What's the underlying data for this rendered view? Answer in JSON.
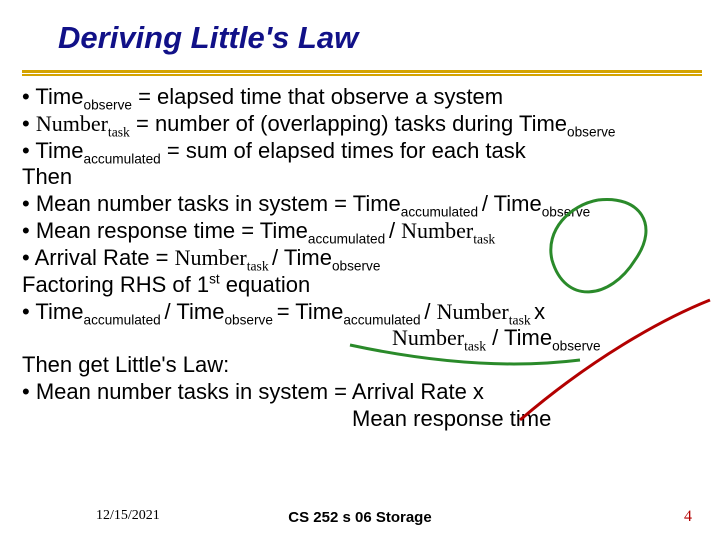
{
  "title": "Deriving Little's Law",
  "bullets": {
    "l1a": "• Time",
    "l1b": "observe",
    "l1c": " = elapsed time that observe a system",
    "l2a": "• ",
    "l2b": "Number",
    "l2c": "task",
    "l2d": " = number of (overlapping) tasks during Time",
    "l2e": "observe",
    "l3a": "• Time",
    "l3b": "accumulated",
    "l3c": " = sum of elapsed times for each task",
    "l4": "Then",
    "l5a": "• Mean number tasks in system = Time",
    "l5b": "accumulated ",
    "l5c": "/ ",
    "l5d": "Time",
    "l5e": "observe",
    "l6a": "• Mean response time = Time",
    "l6b": "accumulated ",
    "l6c": "/ ",
    "l6d": "Number",
    "l6e": "task",
    "l7a": "• Arrival Rate = ",
    "l7b": "Number",
    "l7c": "task ",
    "l7d": "/ Time",
    "l7e": "observe",
    "l8a": "Factoring RHS of 1",
    "l8b": "st",
    "l8c": " equation",
    "l9a": "• Time",
    "l9b": "accumulated ",
    "l9c": "/ Time",
    "l9d": "observe ",
    "l9e": "= Time",
    "l9f": "accumulated ",
    "l9g": "/ ",
    "l9h": "Number",
    "l9i": "task ",
    "l9j": "x",
    "l10a": "Number",
    "l10b": "task",
    "l10c": " / Time",
    "l10d": "observe",
    "l11": "Then get Little's Law:",
    "l12": "• Mean number tasks in system = Arrival Rate x",
    "l13": "Mean response time"
  },
  "footer": {
    "date": "12/15/2021",
    "center": "CS 252 s 06 Storage",
    "num": "4"
  }
}
